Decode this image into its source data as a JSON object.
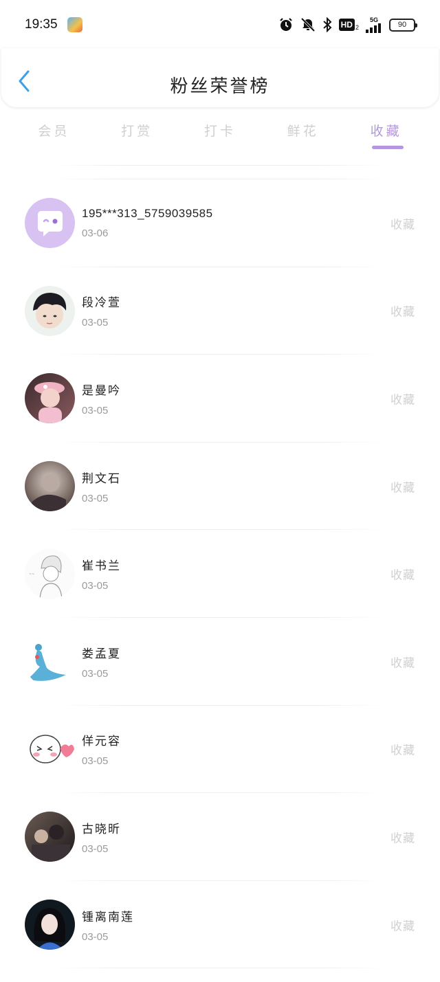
{
  "status_bar": {
    "time": "19:35",
    "network": "5G",
    "hd_label": "HD",
    "hd_sub": "2",
    "battery": "90"
  },
  "header": {
    "title": "粉丝荣誉榜"
  },
  "tabs": [
    {
      "label": "会员",
      "active": false
    },
    {
      "label": "打赏",
      "active": false
    },
    {
      "label": "打卡",
      "active": false
    },
    {
      "label": "鲜花",
      "active": false
    },
    {
      "label": "收藏",
      "active": true
    }
  ],
  "list": [
    {
      "name": "195***313_5759039585",
      "date": "03-06",
      "action": "收藏"
    },
    {
      "name": "段冷萱",
      "date": "03-05",
      "action": "收藏"
    },
    {
      "name": "是曼吟",
      "date": "03-05",
      "action": "收藏"
    },
    {
      "name": "荆文石",
      "date": "03-05",
      "action": "收藏"
    },
    {
      "name": "崔书兰",
      "date": "03-05",
      "action": "收藏"
    },
    {
      "name": "娄孟夏",
      "date": "03-05",
      "action": "收藏"
    },
    {
      "name": "佯元容",
      "date": "03-05",
      "action": "收藏"
    },
    {
      "name": "古晓昕",
      "date": "03-05",
      "action": "收藏"
    },
    {
      "name": "锺离南莲",
      "date": "03-05",
      "action": "收藏"
    }
  ],
  "colors": {
    "accent": "#b596e0",
    "back_arrow": "#3aa0e8",
    "inactive_tab": "#cfcfcf",
    "action_text": "#d0d0d0"
  }
}
